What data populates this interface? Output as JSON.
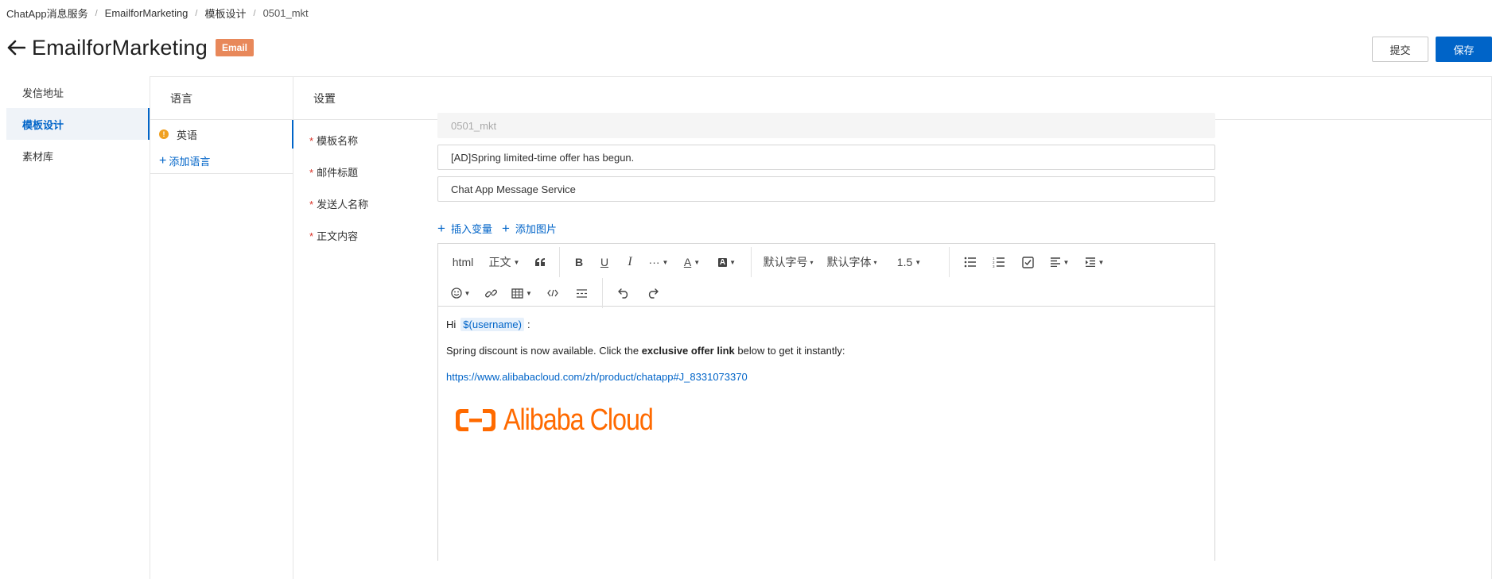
{
  "breadcrumb": {
    "items": [
      "ChatApp消息服务",
      "EmailforMarketing",
      "模板设计",
      "0501_mkt"
    ],
    "separator": "/"
  },
  "header": {
    "title": "EmailforMarketing",
    "tag": "Email",
    "submit_label": "提交",
    "save_label": "保存"
  },
  "leftnav": {
    "items": [
      {
        "label": "发信地址",
        "active": false
      },
      {
        "label": "模板设计",
        "active": true
      },
      {
        "label": "素材库",
        "active": false
      }
    ]
  },
  "language_panel": {
    "heading": "语言",
    "current_language": "英语",
    "add_language_label": "添加语言"
  },
  "settings": {
    "heading": "设置",
    "template_name_label": "模板名称",
    "template_name_value": "0501_mkt",
    "subject_label": "邮件标题",
    "subject_value": "[AD]Spring limited-time offer has begun.",
    "sender_label": "发送人名称",
    "sender_value": "Chat App Message Service",
    "body_label": "正文内容",
    "insert_variable_label": "插入变量",
    "add_image_label": "添加图片"
  },
  "toolbar": {
    "html_label": "html",
    "paragraph_label": "正文",
    "more_label": "···",
    "font_size_label": "默认字号",
    "font_family_label": "默认字体",
    "line_height_label": "1.5"
  },
  "editor_content": {
    "greeting": "Hi",
    "variable": "$(username)",
    "greeting_suffix": ":",
    "line2_before": "Spring discount is now available. Click the ",
    "line2_bold": "exclusive offer link",
    "line2_after": " below to get it instantly:",
    "link": "https://www.alibabacloud.com/zh/product/chatapp#J_8331073370",
    "logo_text": "Alibaba Cloud"
  },
  "colors": {
    "primary": "#0064c8",
    "tag": "#e8885a",
    "brand_orange": "#ff6a00",
    "required": "#d93026"
  }
}
